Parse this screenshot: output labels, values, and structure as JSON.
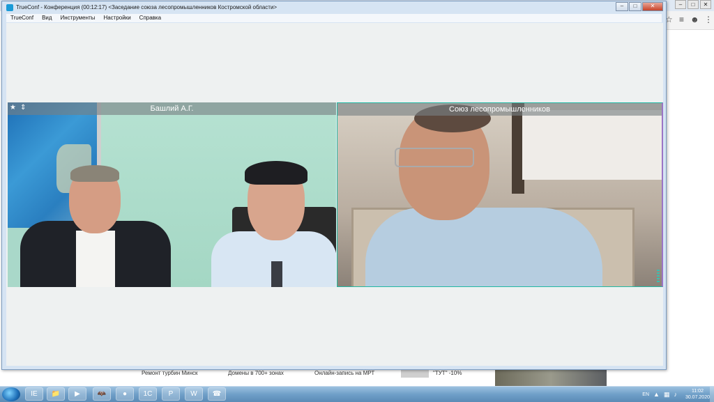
{
  "background": {
    "toolbar_icons": [
      "☆",
      "≡",
      "☻",
      "⋮"
    ],
    "footer_links": [
      "Ремонт турбин Минск",
      "Домены в 700+ зонах",
      "Онлайн-запись на МРТ"
    ],
    "footer_ad_text": "\"ТУТ\" -10%"
  },
  "window": {
    "title": "TrueConf - Конференция (00:12:17) <Заседание союза лесопромышленников Костромской области>",
    "controls": {
      "minimize": "–",
      "maximize": "□",
      "close": "✕"
    }
  },
  "menu": [
    "TrueConf",
    "Вид",
    "Инструменты",
    "Настройки",
    "Справка"
  ],
  "participants": [
    {
      "name": "Башлий А.Г.",
      "icons": [
        "★",
        "⇕"
      ]
    },
    {
      "name": "Союз лесопромышленников"
    }
  ],
  "taskbar": {
    "apps": [
      "IE",
      "📁",
      "▶",
      "🦇",
      "●",
      "1С",
      "P",
      "W",
      "☎"
    ],
    "language": "EN",
    "time": "11:02",
    "date": "30.07.2020"
  },
  "colors": {
    "accent_active_speaker": "#1fb8a3",
    "window_frame": "#d6e4f3",
    "close_button": "#c7432a"
  }
}
